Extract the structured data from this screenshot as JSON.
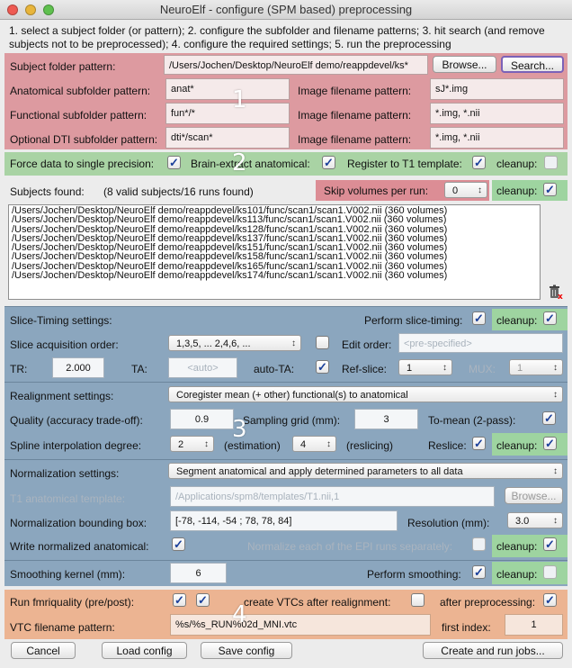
{
  "window": {
    "title": "NeuroElf - configure (SPM based) preprocessing"
  },
  "instructions": "1. select a subject folder (or pattern); 2. configure the subfolder and filename patterns; 3. hit search (and remove subjects not to be preprocessed); 4. configure the required settings; 5. run the preprocessing",
  "section1": {
    "subject_folder_label": "Subject folder pattern:",
    "subject_folder_value": "/Users/Jochen/Desktop/NeuroElf demo/reappdevel/ks*",
    "browse_label": "Browse...",
    "search_label": "Search...",
    "anat_label": "Anatomical subfolder pattern:",
    "anat_value": "anat*",
    "anat_img_label": "Image filename pattern:",
    "anat_img_value": "sJ*.img",
    "func_label": "Functional subfolder pattern:",
    "func_value": "fun*/*",
    "func_img_label": "Image filename pattern:",
    "func_img_value": "*.img, *.nii",
    "dti_label": "Optional DTI subfolder pattern:",
    "dti_value": "dti*/scan*",
    "dti_img_label": "Image filename pattern:",
    "dti_img_value": "*.img, *.nii",
    "marker": "1"
  },
  "section2": {
    "single_precision_label": "Force data to single precision:",
    "brain_extract_label": "Brain-extract anatomical:",
    "register_t1_label": "Register to T1 template:",
    "cleanup_label": "cleanup:",
    "marker": "2"
  },
  "subjects": {
    "found_label": "Subjects found:",
    "count_text": "(8 valid subjects/16 runs found)",
    "skip_label": "Skip volumes per run:",
    "skip_value": "0",
    "cleanup_label": "cleanup:",
    "items": [
      "/Users/Jochen/Desktop/NeuroElf demo/reappdevel/ks101/func/scan1/scan1.V002.nii (360 volumes)",
      "/Users/Jochen/Desktop/NeuroElf demo/reappdevel/ks113/func/scan1/scan1.V002.nii (360 volumes)",
      "/Users/Jochen/Desktop/NeuroElf demo/reappdevel/ks128/func/scan1/scan1.V002.nii (360 volumes)",
      "/Users/Jochen/Desktop/NeuroElf demo/reappdevel/ks137/func/scan1/scan1.V002.nii (360 volumes)",
      "/Users/Jochen/Desktop/NeuroElf demo/reappdevel/ks151/func/scan1/scan1.V002.nii (360 volumes)",
      "/Users/Jochen/Desktop/NeuroElf demo/reappdevel/ks158/func/scan1/scan1.V002.nii (360 volumes)",
      "/Users/Jochen/Desktop/NeuroElf demo/reappdevel/ks165/func/scan1/scan1.V002.nii (360 volumes)",
      "/Users/Jochen/Desktop/NeuroElf demo/reappdevel/ks174/func/scan1/scan1.V002.nii (360 volumes)"
    ]
  },
  "section3": {
    "slice_timing_label": "Slice-Timing settings:",
    "perform_slice_timing_label": "Perform slice-timing:",
    "cleanup_label": "cleanup:",
    "acq_order_label": "Slice acquisition order:",
    "acq_order_value": "1,3,5, ... 2,4,6, ...",
    "edit_order_label": "Edit order:",
    "edit_order_value": "<pre-specified>",
    "tr_label": "TR:",
    "tr_value": "2.000",
    "ta_label": "TA:",
    "ta_value": "<auto>",
    "auto_ta_label": "auto-TA:",
    "ref_slice_label": "Ref-slice:",
    "ref_slice_value": "1",
    "mux_label": "MUX:",
    "mux_value": "1",
    "realign_label": "Realignment settings:",
    "realign_value": "Coregister mean (+ other) functional(s) to anatomical",
    "quality_label": "Quality (accuracy trade-off):",
    "quality_value": "0.9",
    "sampling_label": "Sampling grid (mm):",
    "sampling_value": "3",
    "to_mean_label": "To-mean (2-pass):",
    "spline_label": "Spline interpolation degree:",
    "spline_est_value": "2",
    "estimation_label": "(estimation)",
    "spline_res_value": "4",
    "reslicing_label": "(reslicing)",
    "reslice_label": "Reslice:",
    "norm_label": "Normalization settings:",
    "norm_value": "Segment anatomical and apply determined parameters to all data",
    "t1_template_label": "T1 anatomical template:",
    "t1_template_value": "/Applications/spm8/templates/T1.nii,1",
    "t1_browse_label": "Browse...",
    "bbox_label": "Normalization bounding box:",
    "bbox_value": "[-78, -114, -54 ; 78, 78, 84]",
    "resolution_label": "Resolution (mm):",
    "resolution_value": "3.0",
    "write_anat_label": "Write normalized anatomical:",
    "normalize_each_label": "Normalize each of the EPI runs separately:",
    "smoothing_label": "Smoothing kernel (mm):",
    "smoothing_value": "6",
    "perform_smoothing_label": "Perform smoothing:",
    "marker": "3"
  },
  "section4": {
    "fmriquality_label": "Run fmriquality (pre/post):",
    "create_vtcs_label": "create VTCs after realignment:",
    "after_preproc_label": "after preprocessing:",
    "vtc_pattern_label": "VTC filename pattern:",
    "vtc_pattern_value": "%s/%s_RUN%02d_MNI.vtc",
    "first_index_label": "first index:",
    "first_index_value": "1",
    "marker": "4"
  },
  "buttons": {
    "cancel": "Cancel",
    "load": "Load config",
    "save": "Save config",
    "run": "Create and run jobs..."
  },
  "check_glyph": "✓",
  "colors": {
    "red_section": "#dd9aa0",
    "green_section": "#a9d3a4",
    "blue_section": "#8ba6be",
    "orange_section": "#ecb492",
    "cleanup_green": "#9ed4a0"
  }
}
